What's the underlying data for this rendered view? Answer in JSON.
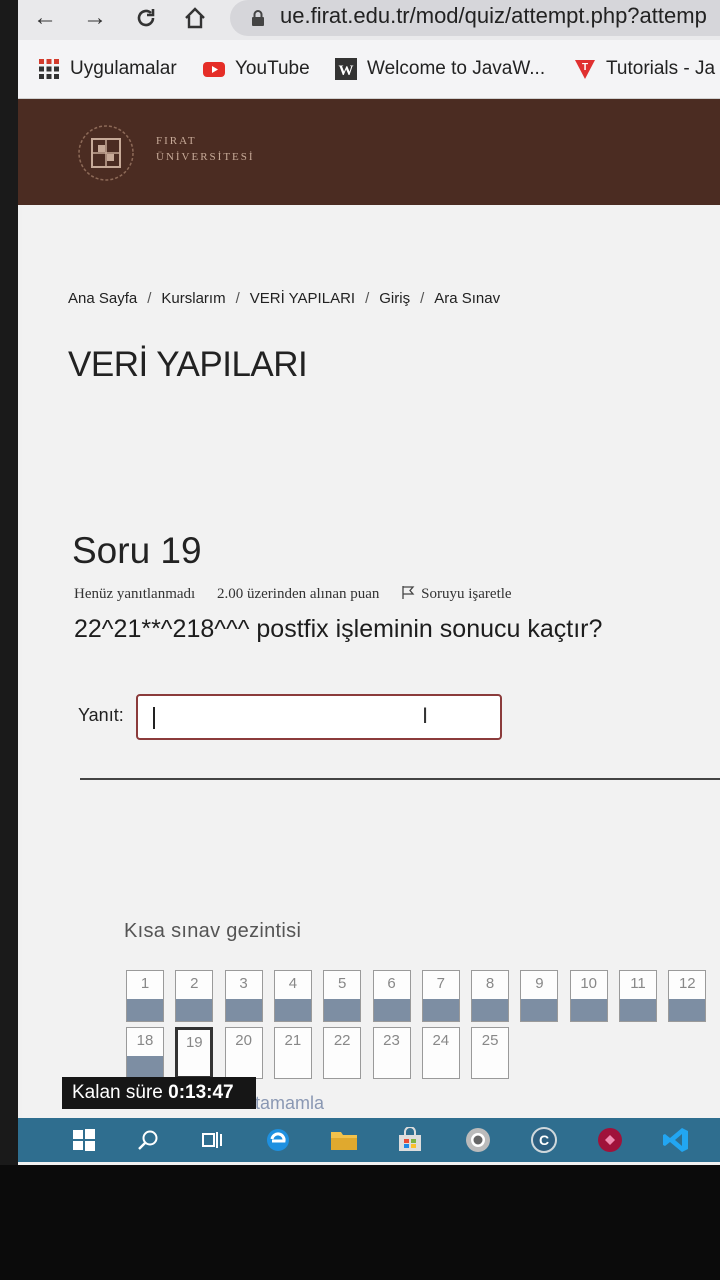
{
  "browser": {
    "url": "ue.firat.edu.tr/mod/quiz/attempt.php?attemp",
    "nav_icons": [
      "back-arrow-icon",
      "forward-arrow-icon",
      "reload-icon",
      "home-icon",
      "lock-icon"
    ],
    "bookmarks": [
      {
        "label": "Uygulamalar",
        "icon": "apps-grid-icon",
        "color": "#d33b2c"
      },
      {
        "label": "YouTube",
        "icon": "youtube-icon",
        "color": "#e52d27"
      },
      {
        "label": "Welcome to JavaW...",
        "icon": "w-logo-icon",
        "color": "#333333"
      },
      {
        "label": "Tutorials - Ja",
        "icon": "tutorials-logo-icon",
        "color": "#e03030"
      }
    ]
  },
  "site": {
    "logo_line1": "FIRAT",
    "logo_line2": "ÜNİVERSİTESİ",
    "header_color": "#4b2c22"
  },
  "breadcrumb": [
    "Ana Sayfa",
    "Kurslarım",
    "VERİ YAPILARI",
    "Giriş",
    "Ara Sınav"
  ],
  "course_title": "VERİ YAPILARI",
  "question": {
    "title": "Soru 19",
    "status": "Henüz yanıtlanmadı",
    "points": "2.00 üzerinden alınan puan",
    "flag_label": "Soruyu işaretle",
    "text": "22^21**^218^^^ postfix işleminin sonucu kaçtır?",
    "answer_label": "Yanıt:",
    "answer_value": ""
  },
  "quiz_nav": {
    "title": "Kısa sınav gezintisi",
    "row1": [
      "1",
      "2",
      "3",
      "4",
      "5",
      "6",
      "7",
      "8",
      "9",
      "10",
      "11",
      "12"
    ],
    "row2": [
      "18",
      "19",
      "20",
      "21",
      "22",
      "23",
      "24",
      "25"
    ],
    "answered": [
      "1",
      "2",
      "3",
      "4",
      "5",
      "6",
      "7",
      "8",
      "9",
      "10",
      "11",
      "12",
      "18"
    ],
    "current": "19",
    "finish_link": "tamamla"
  },
  "timer": {
    "label": "Kalan süre",
    "value": "0:13:47"
  },
  "taskbar_icons": [
    "windows-start-icon",
    "search-icon",
    "task-view-icon",
    "edge-icon",
    "file-explorer-icon",
    "store-icon",
    "chrome-icon",
    "ccleaner-icon",
    "app-icon",
    "vscode-icon"
  ]
}
